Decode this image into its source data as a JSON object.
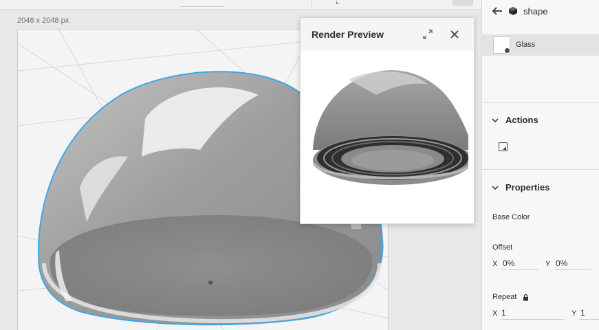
{
  "canvas": {
    "size_label": "2048 x 2048 px"
  },
  "preview": {
    "title": "Render Preview",
    "expand_icon": "expand-icon",
    "close_icon": "close-icon"
  },
  "panel": {
    "shape_label": "shape",
    "material_label": "Glass",
    "actions_label": "Actions",
    "properties_label": "Properties",
    "base_color_label": "Base Color",
    "offset": {
      "label": "Offset",
      "x_axis": "X",
      "x_value": "0%",
      "y_axis": "Y",
      "y_value": "0%"
    },
    "repeat": {
      "label": "Repeat",
      "x_axis": "X",
      "x_value": "1",
      "y_axis": "Y",
      "y_value": "1"
    }
  },
  "colors": {
    "selection_outline": "#3ea8e6",
    "panel_bg": "#f7f7f7",
    "active_row": "#e3e3e3"
  }
}
